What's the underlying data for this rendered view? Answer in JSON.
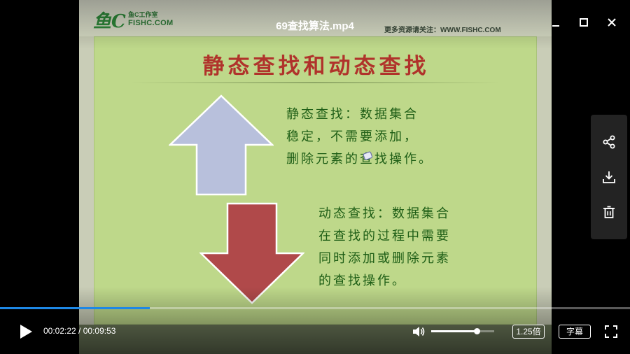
{
  "player": {
    "title": "69查找算法.mp4",
    "current_time": "00:02:22",
    "time_separator": " / ",
    "duration": "00:09:53",
    "progress_fraction": 0.238,
    "volume_fraction": 0.72,
    "speed_label": "1.25倍",
    "caption_label": "字幕",
    "accent_color": "#1e88e5"
  },
  "window_controls": {
    "minimize_icon": "minimize-icon",
    "maximize_icon": "maximize-icon",
    "close_icon": "close-icon"
  },
  "side_actions": [
    {
      "icon": "share-icon"
    },
    {
      "icon": "download-icon"
    },
    {
      "icon": "delete-icon"
    }
  ],
  "slide": {
    "logo_mark": "鱼C",
    "logo_name": "鱼C工作室",
    "logo_domain": "FISHC.COM",
    "site_note": "更多资源请关注：WWW.FISHC.COM",
    "title": "静态查找和动态查找",
    "static_lines": [
      "静态查找：数据集合",
      "稳定，不需要添加，",
      "删除元素的查找操作。"
    ],
    "dynamic_lines": [
      "动态查找：数据集合",
      "在查找的过程中需要",
      "同时添加或删除元素",
      "的查找操作。"
    ],
    "background_color": "#bed88a",
    "title_color": "#b0332b",
    "text_color": "#1e5e16",
    "up_arrow_color": "#b8c0dc",
    "down_arrow_color": "#b0494a"
  }
}
